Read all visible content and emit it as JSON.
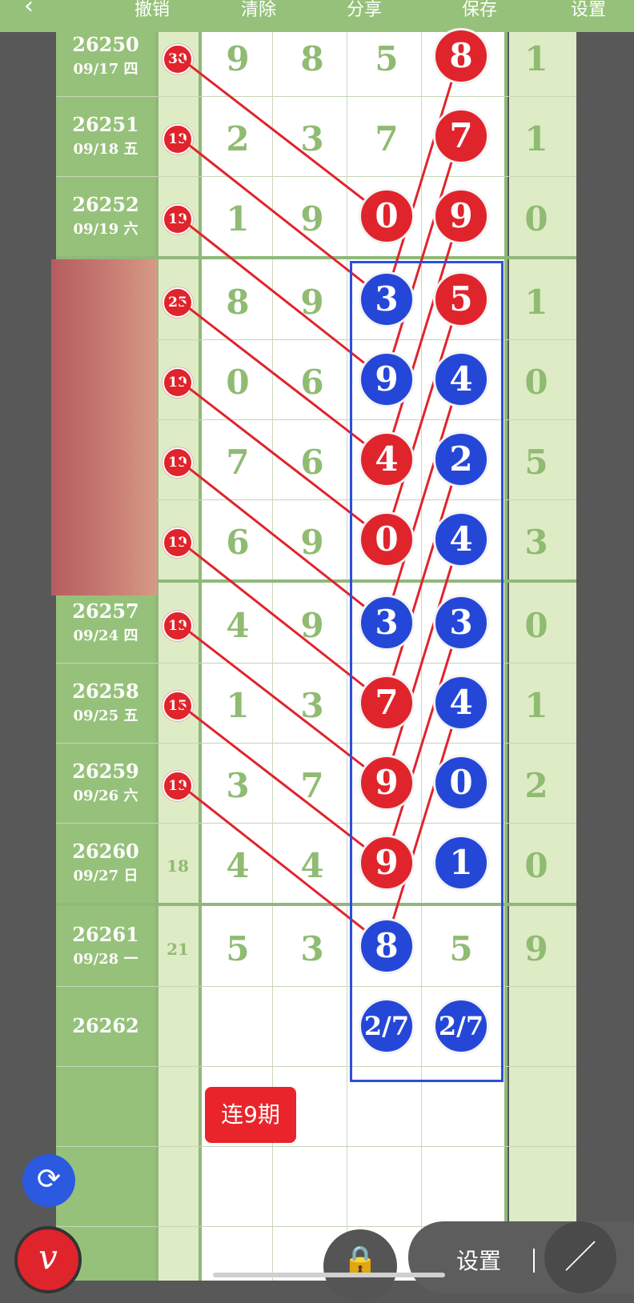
{
  "toolbar": {
    "back_icon": "chevron-left-icon",
    "buttons": [
      "撤销",
      "清除",
      "分享",
      "保存",
      "设置"
    ]
  },
  "rows": [
    {
      "period": "26250",
      "date": "09/17 四",
      "sum": "30",
      "sum_ball": true,
      "digits": [
        "9",
        "8",
        "5",
        "8"
      ],
      "last": "1"
    },
    {
      "period": "26251",
      "date": "09/18 五",
      "sum": "19",
      "sum_ball": true,
      "digits": [
        "2",
        "3",
        "7",
        "7"
      ],
      "last": "1"
    },
    {
      "period": "26252",
      "date": "09/19 六",
      "sum": "19",
      "sum_ball": true,
      "digits": [
        "1",
        "9",
        "0",
        "9"
      ],
      "last": "0"
    },
    {
      "period": "",
      "date": "",
      "sum": "25",
      "sum_ball": true,
      "digits": [
        "8",
        "9",
        "3",
        "5"
      ],
      "last": "1"
    },
    {
      "period": "",
      "date": "",
      "sum": "19",
      "sum_ball": true,
      "digits": [
        "0",
        "6",
        "9",
        "4"
      ],
      "last": "0"
    },
    {
      "period": "",
      "date": "",
      "sum": "19",
      "sum_ball": true,
      "digits": [
        "7",
        "6",
        "4",
        "2"
      ],
      "last": "5"
    },
    {
      "period": "",
      "date": "",
      "sum": "19",
      "sum_ball": true,
      "digits": [
        "6",
        "9",
        "0",
        "4"
      ],
      "last": "3"
    },
    {
      "period": "26257",
      "date": "09/24 四",
      "sum": "19",
      "sum_ball": true,
      "digits": [
        "4",
        "9",
        "3",
        "3"
      ],
      "last": "0"
    },
    {
      "period": "26258",
      "date": "09/25 五",
      "sum": "15",
      "sum_ball": true,
      "digits": [
        "1",
        "3",
        "7",
        "4"
      ],
      "last": "1"
    },
    {
      "period": "26259",
      "date": "09/26 六",
      "sum": "19",
      "sum_ball": true,
      "digits": [
        "3",
        "7",
        "9",
        "0"
      ],
      "last": "2"
    },
    {
      "period": "26260",
      "date": "09/27 日",
      "sum": "18",
      "sum_ball": false,
      "digits": [
        "4",
        "4",
        "9",
        "1"
      ],
      "last": "0"
    },
    {
      "period": "26261",
      "date": "09/28 一",
      "sum": "21",
      "sum_ball": false,
      "digits": [
        "5",
        "3",
        "8",
        "5"
      ],
      "last": "9"
    },
    {
      "period": "26262",
      "date": "",
      "sum": "",
      "sum_ball": false,
      "digits": [
        "",
        "",
        "2/7",
        "2/7"
      ],
      "last": ""
    }
  ],
  "marked_balls": [
    {
      "row": 0,
      "col": 3,
      "color": "red"
    },
    {
      "row": 1,
      "col": 3,
      "color": "red"
    },
    {
      "row": 2,
      "col": 2,
      "color": "red"
    },
    {
      "row": 2,
      "col": 3,
      "color": "red"
    },
    {
      "row": 3,
      "col": 2,
      "color": "blue"
    },
    {
      "row": 3,
      "col": 3,
      "color": "red"
    },
    {
      "row": 4,
      "col": 2,
      "color": "blue"
    },
    {
      "row": 4,
      "col": 3,
      "color": "blue"
    },
    {
      "row": 5,
      "col": 2,
      "color": "red"
    },
    {
      "row": 5,
      "col": 3,
      "color": "blue"
    },
    {
      "row": 6,
      "col": 2,
      "color": "red"
    },
    {
      "row": 6,
      "col": 3,
      "color": "blue"
    },
    {
      "row": 7,
      "col": 2,
      "color": "blue"
    },
    {
      "row": 7,
      "col": 3,
      "color": "blue"
    },
    {
      "row": 8,
      "col": 2,
      "color": "red"
    },
    {
      "row": 8,
      "col": 3,
      "color": "blue"
    },
    {
      "row": 9,
      "col": 2,
      "color": "red"
    },
    {
      "row": 9,
      "col": 3,
      "color": "blue"
    },
    {
      "row": 10,
      "col": 2,
      "color": "red"
    },
    {
      "row": 10,
      "col": 3,
      "color": "blue"
    },
    {
      "row": 11,
      "col": 2,
      "color": "blue"
    },
    {
      "row": 12,
      "col": 2,
      "color": "blue"
    },
    {
      "row": 12,
      "col": 3,
      "color": "blue"
    }
  ],
  "links": [
    {
      "from": [
        0,
        "sum"
      ],
      "to": [
        2,
        2
      ]
    },
    {
      "from": [
        1,
        "sum"
      ],
      "to": [
        3,
        2
      ]
    },
    {
      "from": [
        2,
        "sum"
      ],
      "to": [
        4,
        2
      ]
    },
    {
      "from": [
        3,
        "sum"
      ],
      "to": [
        5,
        2
      ]
    },
    {
      "from": [
        4,
        "sum"
      ],
      "to": [
        6,
        2
      ]
    },
    {
      "from": [
        5,
        "sum"
      ],
      "to": [
        7,
        2
      ]
    },
    {
      "from": [
        6,
        "sum"
      ],
      "to": [
        8,
        2
      ]
    },
    {
      "from": [
        7,
        "sum"
      ],
      "to": [
        9,
        2
      ]
    },
    {
      "from": [
        8,
        "sum"
      ],
      "to": [
        10,
        2
      ]
    },
    {
      "from": [
        9,
        "sum"
      ],
      "to": [
        11,
        2
      ]
    },
    {
      "from": [
        0,
        3
      ],
      "to": [
        3,
        2
      ]
    },
    {
      "from": [
        1,
        3
      ],
      "to": [
        4,
        2
      ]
    },
    {
      "from": [
        2,
        3
      ],
      "to": [
        5,
        2
      ]
    },
    {
      "from": [
        3,
        3
      ],
      "to": [
        6,
        2
      ]
    },
    {
      "from": [
        4,
        3
      ],
      "to": [
        7,
        2
      ]
    },
    {
      "from": [
        5,
        3
      ],
      "to": [
        8,
        2
      ]
    },
    {
      "from": [
        6,
        3
      ],
      "to": [
        9,
        2
      ]
    },
    {
      "from": [
        7,
        3
      ],
      "to": [
        10,
        2
      ]
    },
    {
      "from": [
        8,
        3
      ],
      "to": [
        11,
        2
      ]
    }
  ],
  "streak_badge": "连9期",
  "bottom": {
    "settings_label": "设置",
    "refresh_icon": "refresh-icon",
    "pen_icon": "pen-icon",
    "lock_icon": "lock-icon",
    "draw_icon": "line-draw-icon"
  },
  "colors": {
    "green": "#96c17a",
    "light_green": "#deecc5",
    "red": "#e0242c",
    "blue": "#2547d8",
    "frame_blue": "#2a4fd8"
  }
}
